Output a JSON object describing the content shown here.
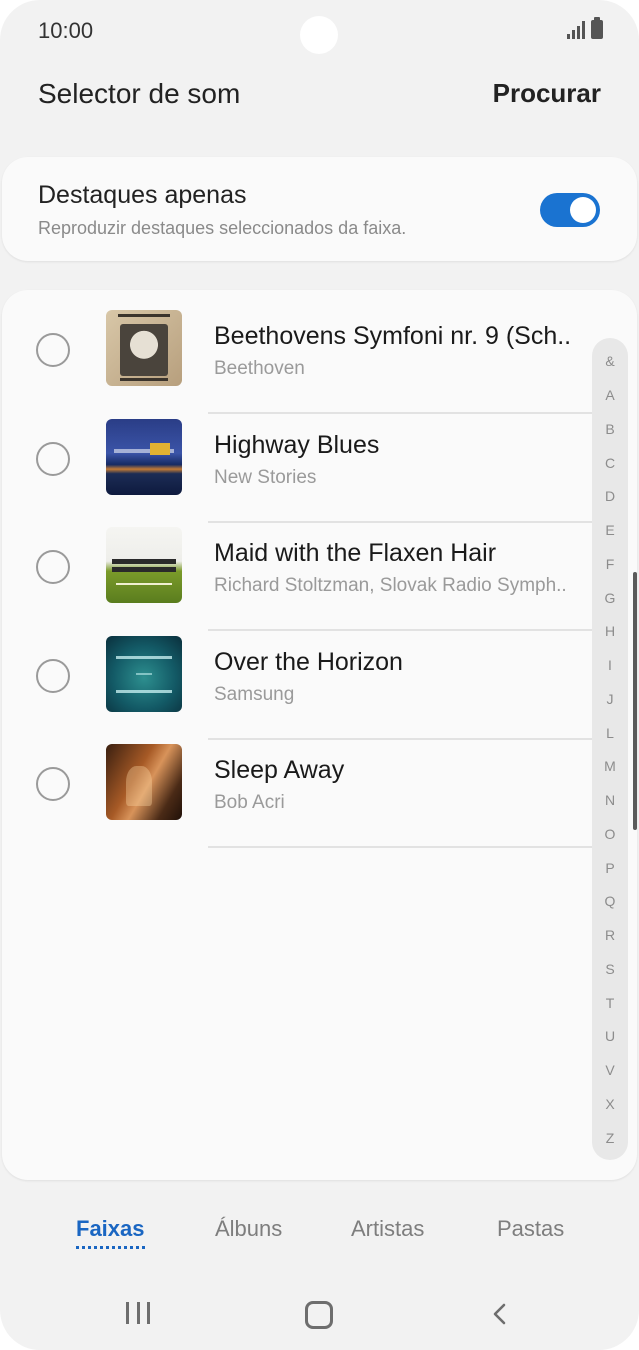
{
  "status_bar": {
    "time": "10:00"
  },
  "header": {
    "title": "Selector de som",
    "search_label": "Procurar"
  },
  "highlights": {
    "title": "Destaques apenas",
    "subtitle": "Reproduzir destaques seleccionados da faixa.",
    "toggle_on": true,
    "accent_color": "#1a73d1"
  },
  "tracks": [
    {
      "title": "Beethovens Symfoni nr. 9 (Sch..",
      "artist": "Beethoven",
      "selected": false
    },
    {
      "title": "Highway Blues",
      "artist": "New Stories",
      "selected": false
    },
    {
      "title": "Maid with the Flaxen Hair",
      "artist": "Richard Stoltzman, Slovak Radio Symph..",
      "selected": false
    },
    {
      "title": "Over the Horizon",
      "artist": "Samsung",
      "selected": false
    },
    {
      "title": "Sleep Away",
      "artist": "Bob Acri",
      "selected": false
    }
  ],
  "index_letters": [
    "&",
    "A",
    "B",
    "C",
    "D",
    "E",
    "F",
    "G",
    "H",
    "I",
    "J",
    "L",
    "M",
    "N",
    "O",
    "P",
    "Q",
    "R",
    "S",
    "T",
    "U",
    "V",
    "X",
    "Z"
  ],
  "tabs": [
    {
      "label": "Faixas",
      "active": true
    },
    {
      "label": "Álbuns",
      "active": false
    },
    {
      "label": "Artistas",
      "active": false
    },
    {
      "label": "Pastas",
      "active": false
    }
  ],
  "nav": {
    "recent_icon": "recent-apps-icon",
    "home_icon": "home-icon",
    "back_icon": "back-icon"
  }
}
